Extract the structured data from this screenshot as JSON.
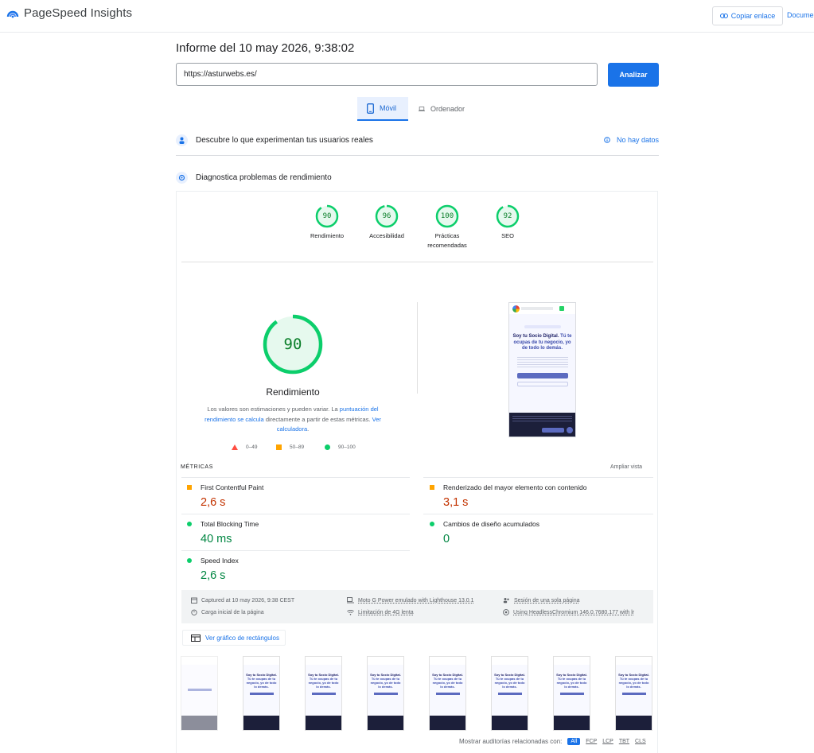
{
  "header": {
    "brand": "PageSpeed Insights",
    "copy_link": "Copiar enlace",
    "docs": "Docume"
  },
  "report": {
    "title": "Informe del 10 may 2026, 9:38:02",
    "url_value": "https://asturwebs.es/",
    "analyze": "Analizar"
  },
  "tabs": [
    {
      "label": "Móvil",
      "icon": "phone-icon",
      "selected": true
    },
    {
      "label": "Ordenador",
      "icon": "laptop-icon",
      "selected": false
    }
  ],
  "field_section": {
    "label": "Descubre lo que experimentan tus usuarios reales",
    "status": "No hay datos"
  },
  "lab_section": {
    "label": "Diagnostica problemas de rendimiento"
  },
  "scores": [
    {
      "value": "90",
      "label": "Rendimiento",
      "fraction": 0.9
    },
    {
      "value": "96",
      "label": "Accesibilidad",
      "fraction": 0.96
    },
    {
      "value": "100",
      "label": "Prácticas recomendadas",
      "fraction": 1.0
    },
    {
      "value": "92",
      "label": "SEO",
      "fraction": 0.92
    }
  ],
  "main_gauge": {
    "value": "90",
    "title": "Rendimiento",
    "fraction": 0.9,
    "desc_before": "Los valores son estimaciones y pueden variar. La ",
    "desc_link1": "puntuación del rendimiento se calcula",
    "desc_middle": " directamente a partir de estas métricas. ",
    "desc_link2": "Ver calculadora",
    "desc_after": "."
  },
  "legend": [
    "0–49",
    "50–89",
    "90–100"
  ],
  "colors": {
    "accent": "#1a73e8",
    "pass": "#0cce6b",
    "average": "#ffa400",
    "fail": "#ff4e42"
  },
  "metrics": {
    "heading": "MÉTRICAS",
    "expand": "Ampliar vista",
    "items": [
      {
        "name": "First Contentful Paint",
        "value": "2,6 s",
        "rating": "average"
      },
      {
        "name": "Renderizado del mayor elemento con contenido",
        "value": "3,1 s",
        "rating": "average"
      },
      {
        "name": "Total Blocking Time",
        "value": "40 ms",
        "rating": "pass"
      },
      {
        "name": "Cambios de diseño acumulados",
        "value": "0",
        "rating": "pass"
      },
      {
        "name": "Speed Index",
        "value": "2,6 s",
        "rating": "pass"
      }
    ]
  },
  "environment": {
    "captured": "Captured at 10 may 2026, 9:38 CEST",
    "initial_load": "Carga inicial de la página",
    "device": "Moto G Power emulado with Lighthouse 13.0.1",
    "throttling": "Limitación de 4G lenta",
    "session": "Sesión de una sola página",
    "browser": "Using HeadlessChromium 146.0.7680.177 with lr"
  },
  "treemap": "Ver gráfico de rectángulos",
  "screenshot": {
    "heading_line1": "Soy tu Socio Digital.",
    "heading_line2": "Tú te ocupas de tu negocio, yo de todo lo demás."
  },
  "audits": {
    "label": "Mostrar auditorías relacionadas con:",
    "chips": [
      "All",
      "FCP",
      "LCP",
      "TBT",
      "CLS"
    ]
  }
}
